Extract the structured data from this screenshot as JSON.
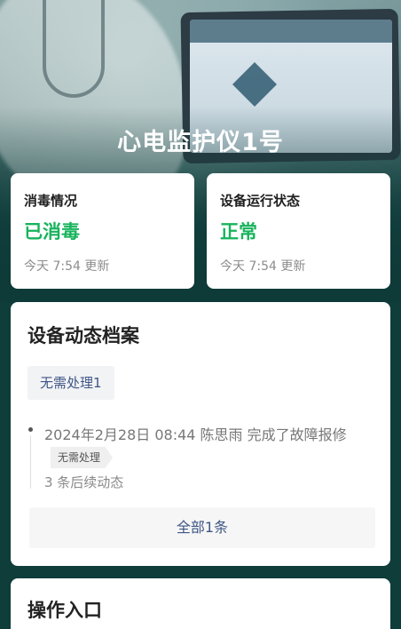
{
  "device": {
    "title": "心电监护仪1号"
  },
  "status_cards": [
    {
      "label": "消毒情况",
      "value": "已消毒",
      "updated": "今天 7:54 更新"
    },
    {
      "label": "设备运行状态",
      "value": "正常",
      "updated": "今天 7:54 更新"
    }
  ],
  "archive": {
    "title": "设备动态档案",
    "filter_tag": "无需处理1",
    "events": [
      {
        "text": "2024年2月28日 08:44  陈思雨 完成了故障报修",
        "badge": "无需处理",
        "followups": "3 条后续动态"
      }
    ],
    "all_button": "全部1条"
  },
  "operations": {
    "title": "操作入口"
  },
  "colors": {
    "accent_green": "#17b35c",
    "link_blue": "#3e5685",
    "background_teal": "#0f3d3a"
  }
}
